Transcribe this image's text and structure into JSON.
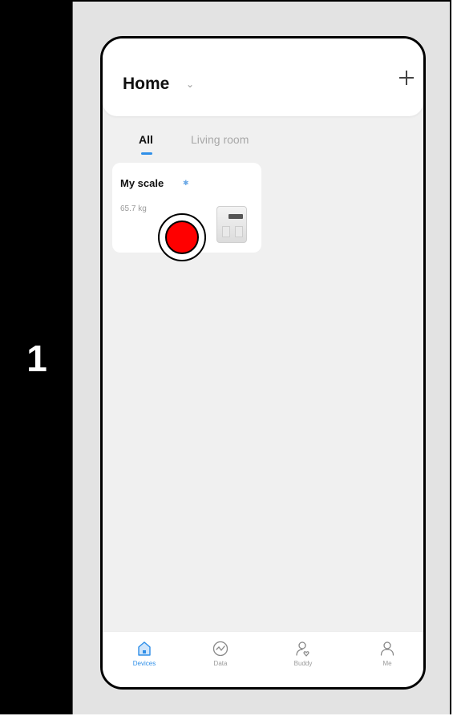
{
  "step": {
    "number": "1"
  },
  "app": {
    "home_title": "Home",
    "tabs": [
      {
        "label": "All",
        "active": true
      },
      {
        "label": "Living room",
        "active": false
      }
    ],
    "device_card": {
      "name": "My scale",
      "weight": "65.7 kg",
      "icon": "scale-icon",
      "status_icon": "bluetooth-icon"
    },
    "tap_indicator": {
      "color": "#ff0000"
    },
    "bottom_nav": [
      {
        "label": "Devices",
        "icon": "home-device-icon",
        "active": true
      },
      {
        "label": "Data",
        "icon": "activity-chart-icon",
        "active": false
      },
      {
        "label": "Buddy",
        "icon": "buddy-icon",
        "active": false
      },
      {
        "label": "Me",
        "icon": "person-icon",
        "active": false
      }
    ],
    "accent_color": "#2f8fe8"
  }
}
